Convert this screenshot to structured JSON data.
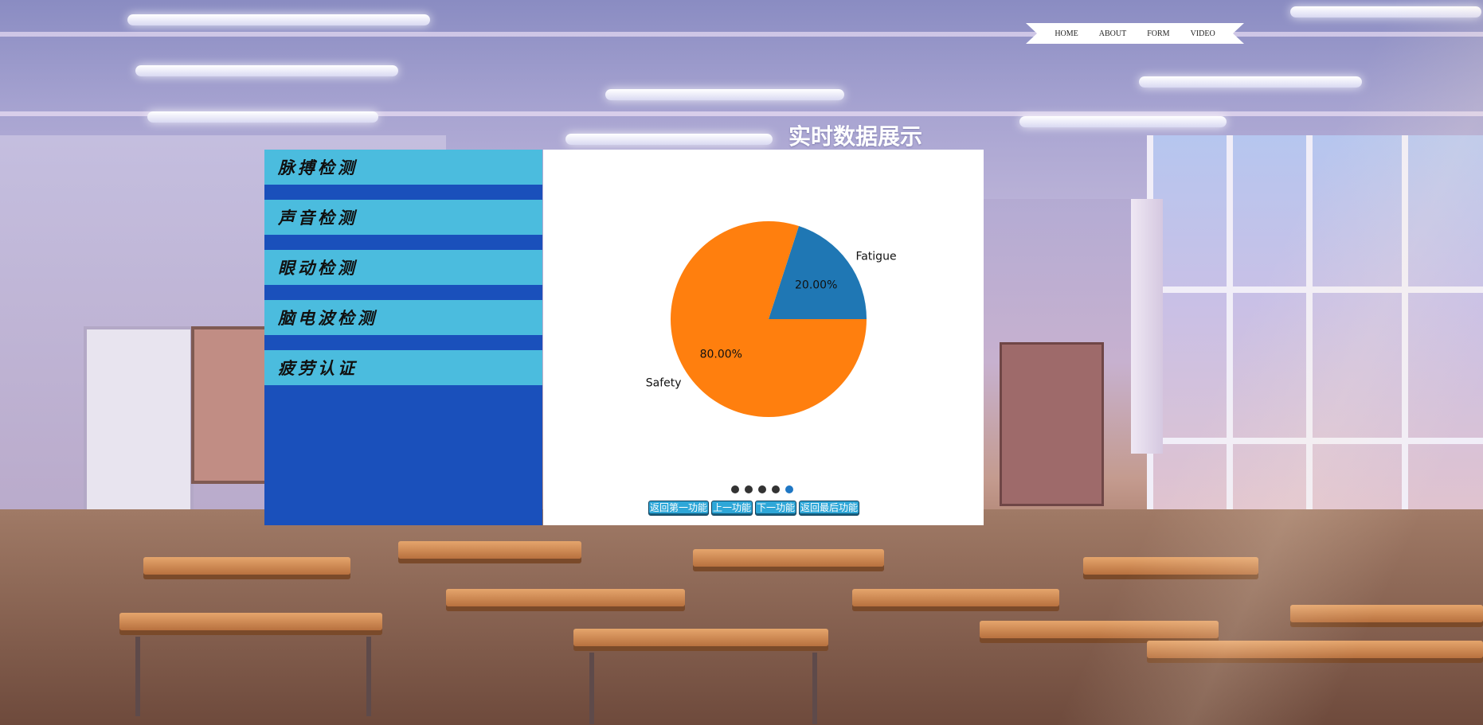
{
  "nav": {
    "items": [
      "HOME",
      "ABOUT",
      "FORM",
      "VIDEO"
    ]
  },
  "page_title": "实时数据展示",
  "sidebar": {
    "items": [
      {
        "label": "脉搏检测"
      },
      {
        "label": "声音检测"
      },
      {
        "label": "眼动检测"
      },
      {
        "label": "脑电波检测"
      },
      {
        "label": "疲劳认证"
      }
    ]
  },
  "chart_data": {
    "type": "pie",
    "categories": [
      "Fatigue",
      "Safety"
    ],
    "values": [
      20.0,
      80.0
    ],
    "value_labels": [
      "20.00%",
      "80.00%"
    ],
    "colors": [
      "#1f77b4",
      "#ff7f0e"
    ],
    "title": ""
  },
  "carousel": {
    "slide_count": 5,
    "active_index": 4
  },
  "controls": {
    "first": "返回第一功能",
    "prev": "上一功能",
    "next": "下一功能",
    "last": "返回最后功能"
  }
}
